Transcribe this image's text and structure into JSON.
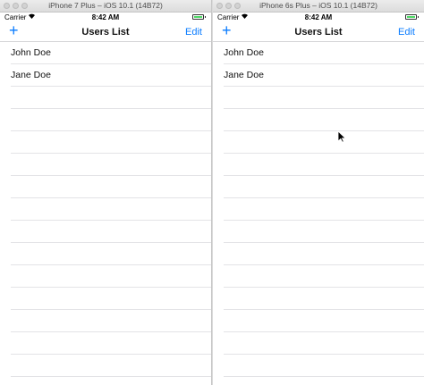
{
  "left_sim": {
    "window_title": "iPhone 7 Plus – iOS 10.1 (14B72)",
    "carrier": "Carrier",
    "time": "8:42 AM",
    "nav": {
      "add_label": "+",
      "title": "Users List",
      "edit_label": "Edit"
    },
    "rows": [
      "John Doe",
      "Jane Doe"
    ]
  },
  "right_sim": {
    "window_title": "iPhone 6s Plus – iOS 10.1 (14B72)",
    "carrier": "Carrier",
    "time": "8:42 AM",
    "nav": {
      "add_label": "+",
      "title": "Users List",
      "edit_label": "Edit"
    },
    "rows": [
      "John Doe",
      "Jane Doe"
    ]
  },
  "colors": {
    "tint": "#0a7cff",
    "battery": "#4cd964",
    "separator": "#e3e3e6"
  },
  "icons": [
    "wifi-icon",
    "battery-icon",
    "add-icon",
    "cursor-icon"
  ]
}
